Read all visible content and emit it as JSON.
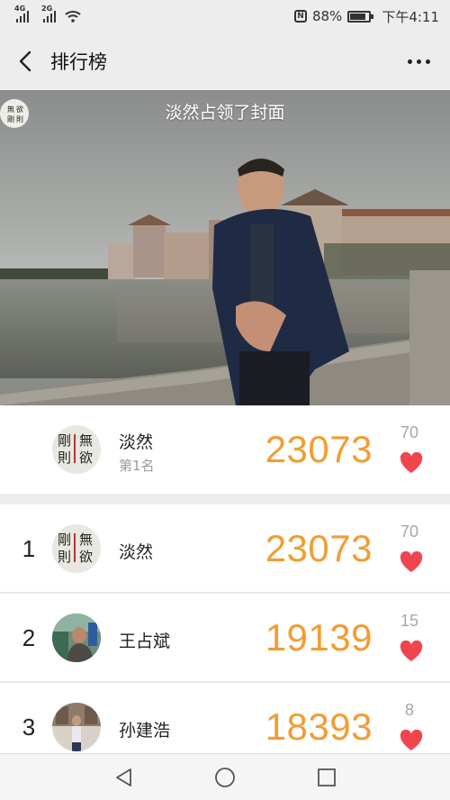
{
  "status_bar": {
    "signal1": "4G",
    "signal2": "2G",
    "battery_percent": "88%",
    "time": "下午4:11"
  },
  "header": {
    "title": "排行榜"
  },
  "cover": {
    "banner_text": "淡然占领了封面"
  },
  "my_rank": {
    "name": "淡然",
    "rank_label": "第1名",
    "steps": "23073",
    "likes": "70"
  },
  "ranking": [
    {
      "rank": "1",
      "name": "淡然",
      "steps": "23073",
      "likes": "70"
    },
    {
      "rank": "2",
      "name": "王占斌",
      "steps": "19139",
      "likes": "15"
    },
    {
      "rank": "3",
      "name": "孙建浩",
      "steps": "18393",
      "likes": "8"
    }
  ],
  "colors": {
    "steps": "#f39c32",
    "heart": "#f0454f",
    "likes": "#a7a7a7"
  }
}
